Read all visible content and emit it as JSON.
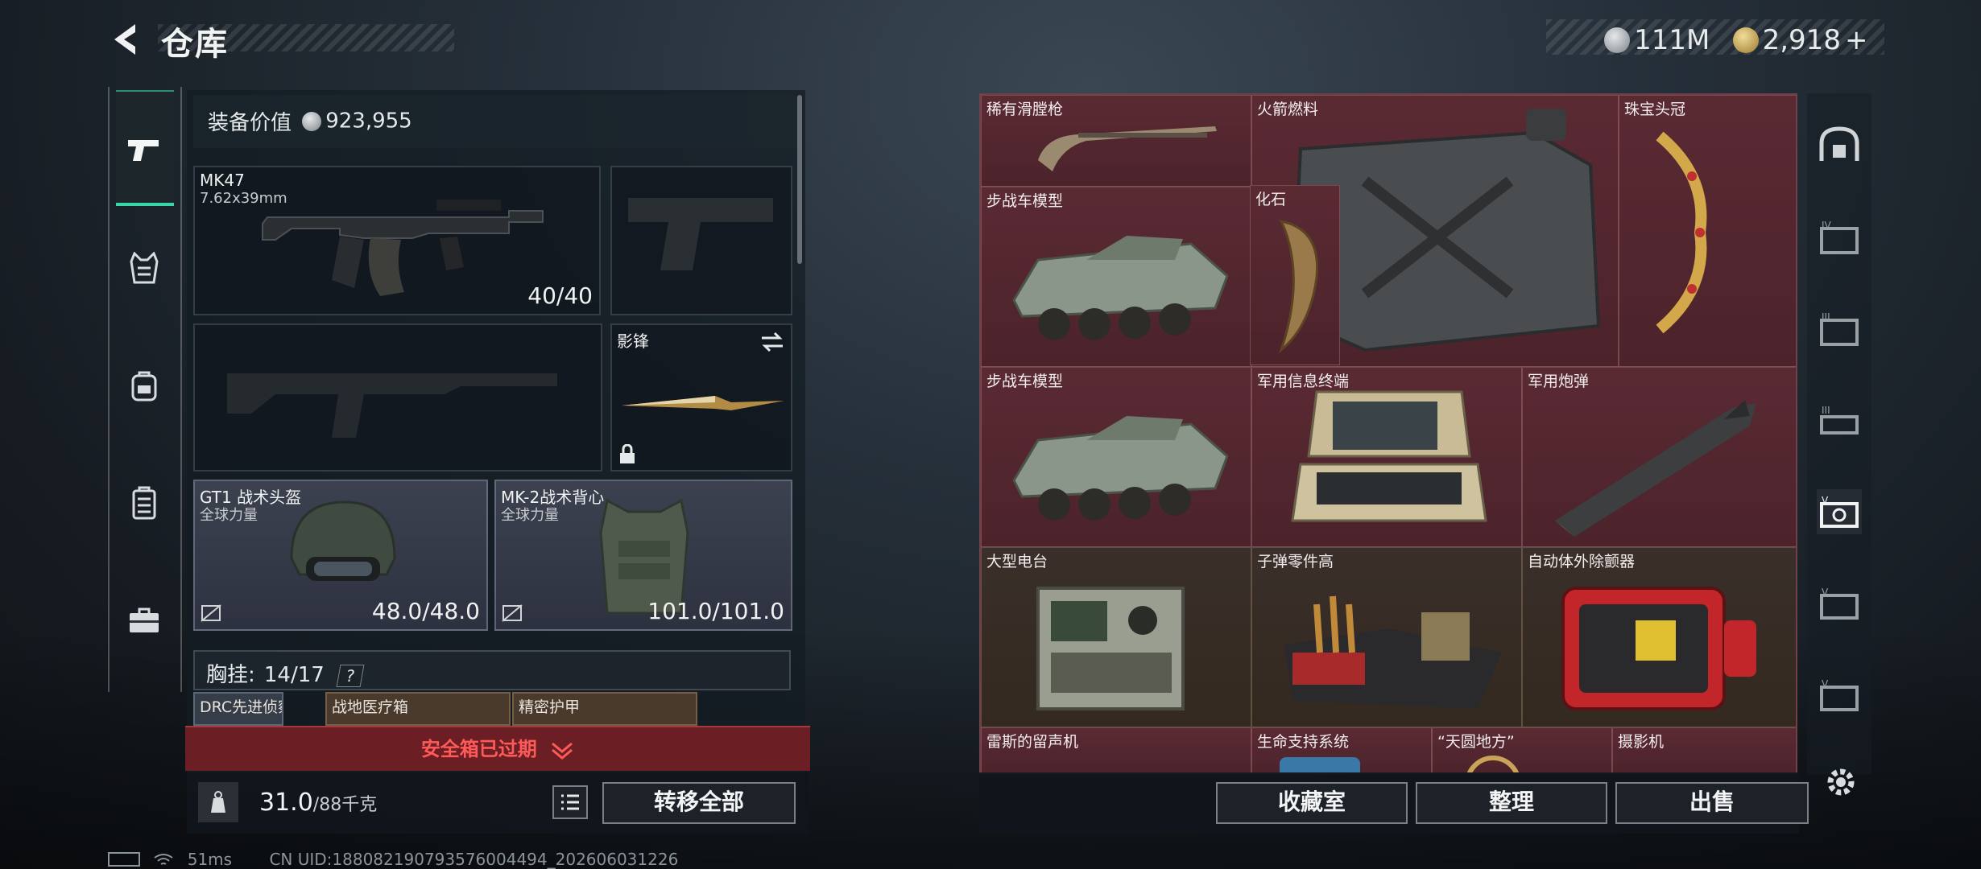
{
  "header": {
    "title": "仓库"
  },
  "currency": {
    "silver": "111M",
    "gold": "2,918",
    "add": "+"
  },
  "equipment": {
    "label": "装备价值",
    "value": "923,955"
  },
  "weapons": {
    "primary": {
      "name": "MK47",
      "caliber": "7.62x39mm",
      "ammo": "40/40"
    },
    "melee": {
      "name": "影锋"
    }
  },
  "armor": {
    "helmet": {
      "name": "GT1 战术头盔",
      "brand": "全球力量",
      "durability": "48.0/48.0"
    },
    "vest": {
      "name": "MK-2战术背心",
      "brand": "全球力量",
      "durability": "101.0/101.0"
    }
  },
  "chest_rig": {
    "label": "胸挂:",
    "count": "14/17",
    "help": "?"
  },
  "chest_items": [
    "DRC先进侦察...",
    "战地医疗箱",
    "精密护甲"
  ],
  "safe_box": {
    "label": "安全箱已过期"
  },
  "weight": {
    "current": "31.0",
    "max": "/88千克"
  },
  "buttons": {
    "transfer_all": "转移全部",
    "collection": "收藏室",
    "sort": "整理",
    "sell": "出售"
  },
  "grid_items": [
    {
      "label": "稀有滑膛枪"
    },
    {
      "label": "火箭燃料"
    },
    {
      "label": "珠宝头冠"
    },
    {
      "label": "步战车模型"
    },
    {
      "label": "化石"
    },
    {
      "label": "步战车模型"
    },
    {
      "label": "军用信息终端"
    },
    {
      "label": "军用炮弹"
    },
    {
      "label": "大型电台"
    },
    {
      "label": "子弹零件高"
    },
    {
      "label": "自动体外除颤器"
    },
    {
      "label": "雷斯的留声机"
    },
    {
      "label": "生命支持系统"
    },
    {
      "label": "“天圆地方”"
    },
    {
      "label": "摄影机"
    }
  ],
  "status": {
    "ping": "51ms",
    "uid": "CN UID:188082190793576004494_202606031226"
  },
  "colors": {
    "accent": "#36d6a6",
    "grid_bg": "#4c232b",
    "expired": "#ff5a5a"
  }
}
